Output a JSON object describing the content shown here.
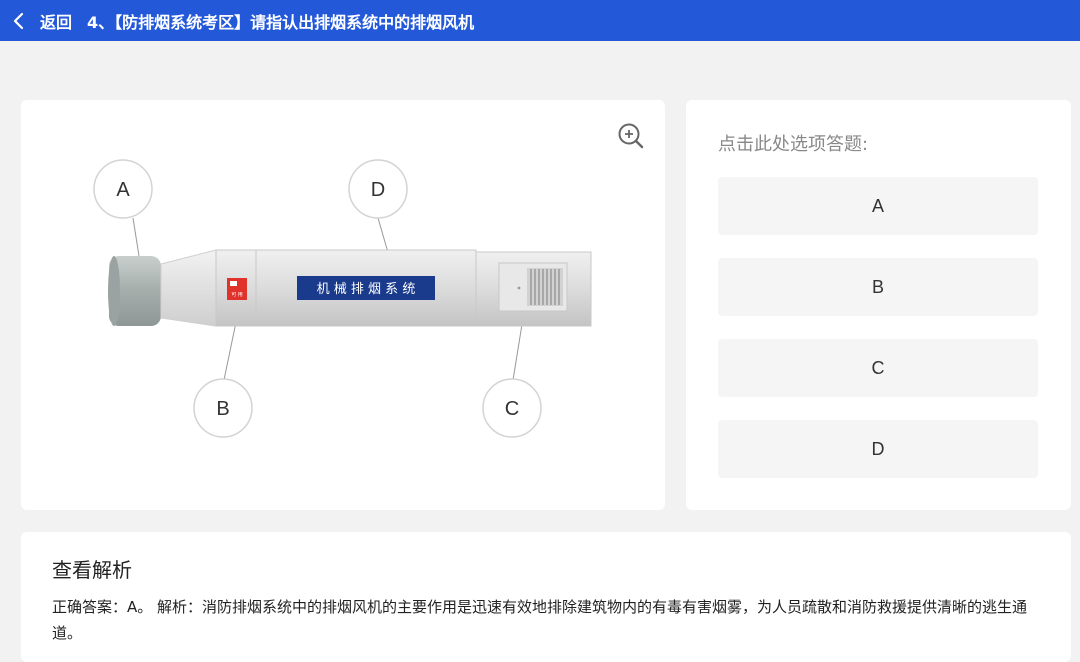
{
  "header": {
    "back_label": "返回",
    "title": "4、【防排烟系统考区】请指认出排烟系统中的排烟风机"
  },
  "diagram": {
    "sign_text": "机 械 排 烟 系 统",
    "labels": {
      "a": "A",
      "b": "B",
      "c": "C",
      "d": "D"
    },
    "tag_text": "可 用",
    "icons": {
      "zoom": "zoom-in-icon",
      "back": "chevron-left-icon"
    }
  },
  "options": {
    "hint": "点击此处选项答题:",
    "items": [
      {
        "label": "A"
      },
      {
        "label": "B"
      },
      {
        "label": "C"
      },
      {
        "label": "D"
      }
    ]
  },
  "analysis": {
    "title": "查看解析",
    "text": "正确答案：A。 解析：消防排烟系统中的排烟风机的主要作用是迅速有效地排除建筑物内的有毒有害烟雾，为人员疏散和消防救援提供清晰的逃生通道。"
  },
  "colors": {
    "header_bg": "#2359d9",
    "sign_bg": "#1a3a8c",
    "tag_red": "#e0312b"
  }
}
